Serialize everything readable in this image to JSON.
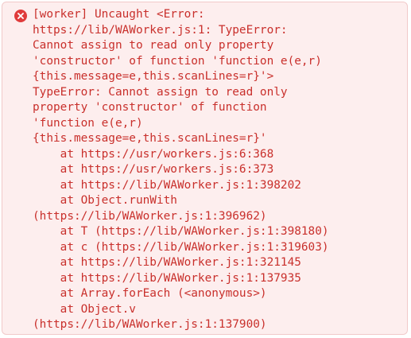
{
  "console": {
    "level_icon": "error-x-icon",
    "colors": {
      "background": "#fdeeee",
      "border": "#f1c9c9",
      "text": "#c9302c",
      "icon": "#e03b3b"
    },
    "lines": [
      "[worker] Uncaught <Error:",
      "https://lib/WAWorker.js:1: TypeError:",
      "Cannot assign to read only property",
      "'constructor' of function 'function e(e,r)",
      "{this.message=e,this.scanLines=r}'>",
      "TypeError: Cannot assign to read only",
      "property 'constructor' of function",
      "'function e(e,r)",
      "{this.message=e,this.scanLines=r}'",
      "    at https://usr/workers.js:6:368",
      "    at https://usr/workers.js:6:373",
      "    at https://lib/WAWorker.js:1:398202",
      "    at Object.runWith",
      "(https://lib/WAWorker.js:1:396962)",
      "    at T (https://lib/WAWorker.js:1:398180)",
      "    at c (https://lib/WAWorker.js:1:319603)",
      "    at https://lib/WAWorker.js:1:321145",
      "    at https://lib/WAWorker.js:1:137935",
      "    at Array.forEach (<anonymous>)",
      "    at Object.v",
      "(https://lib/WAWorker.js:1:137900)"
    ]
  }
}
